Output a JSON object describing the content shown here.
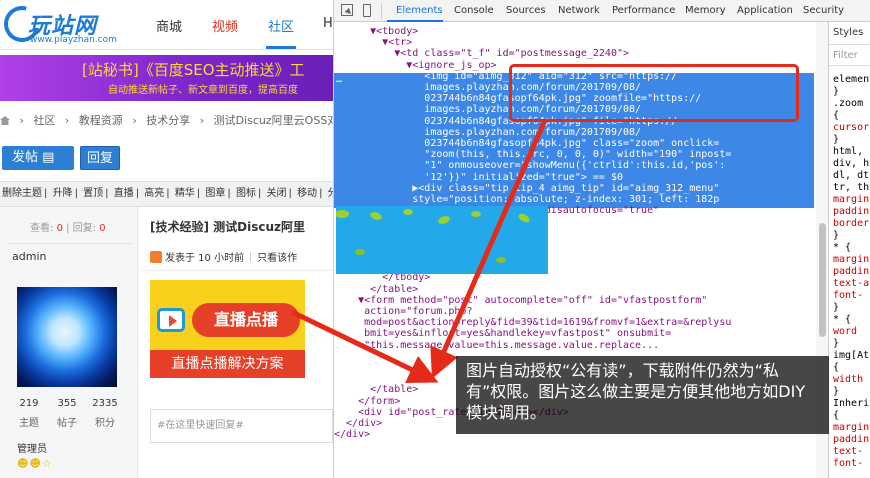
{
  "site": {
    "logo_text": "玩站网",
    "logo_url": "www.playzhan.com",
    "nav": [
      "商城",
      "视频",
      "社区",
      "H"
    ],
    "banner_line1": "[站秘书]《百度SEO主动推送》工",
    "banner_line2": "自动推送新帖子、新文章到百度，提高百度",
    "breadcrumb": [
      "社区",
      "教程资源",
      "技术分享",
      "测试Discuz阿里云OSS对接"
    ],
    "post_button": "发帖",
    "reply_button": "回复",
    "mod_actions": [
      "删除主题",
      "升降",
      "置顶",
      "直播",
      "高亮",
      "精华",
      "图章",
      "图标",
      "关闭",
      "移动",
      "分类"
    ],
    "view_label": "查看:",
    "view_count": "0",
    "reply_label": "回复:",
    "reply_count": "0",
    "author": "admin",
    "stats": [
      {
        "value": "219",
        "label": "主题"
      },
      {
        "value": "355",
        "label": "帖子"
      },
      {
        "value": "2335",
        "label": "积分"
      }
    ],
    "role": "管理员",
    "post_title": "[技术经验] 测试Discuz阿里",
    "post_meta_time": "发表于 10 小时前",
    "post_meta_only": "只看该作",
    "promo_pill": "直播点播",
    "promo_strip": "直播点播解决方案",
    "quick_reply_placeholder": "#在这里快速回复#"
  },
  "devtools": {
    "tabs": [
      "Elements",
      "Console",
      "Sources",
      "Network",
      "Performance",
      "Memory",
      "Application",
      "Security"
    ],
    "active_tab": "Elements",
    "styles_tab": "Styles",
    "filter_placeholder": "Filter",
    "code_lines": [
      "      ▼<tbody>",
      "        ▼<tr>",
      "          ▼<td class=\"t_f\" id=\"postmessage_2240\">",
      "            ▼<ignore_js_op>",
      "               <img id=\"aimg_312\" aid=\"312\" src=\"https://",
      "               images.playzhan.com/forum/201709/08/",
      "               023744b6n84gfasopf64pk.jpg\" zoomfile=\"https://",
      "               images.playzhan.com/forum/201709/08/",
      "               023744b6n84gfasopf64pk.jpg\" file=\"https://",
      "               images.playzhan.com/forum/201709/08/",
      "               023744b6n84gfasopf64pk.jpg\" class=\"zoom\" onclick=",
      "               \"zoom(this, this.src, 0, 0, 0)\" width=\"190\" inpost=",
      "               \"1\" onmouseover=\"showMenu({'ctrlid':this.id,'pos':",
      "               '12'})\" initialized=\"true\"> == $0",
      "             ▶<div class=\"tip tip_4 aimg_tip\" id=\"aimg_312_menu\"",
      "             style=\"position: absolute; z-index: 301; left: 182p",
      "                   display: none;\" disautofocus=\"true\"",
      "                   \"true\">…</div>",
      "                 op>",
      "",
      "",
      "          </tr>",
      "        </tbody>",
      "      </table>",
      "    ▼<form method=\"post\" autocomplete=\"off\" id=\"vfastpostform\"",
      "     action=\"forum.php?",
      "     mod=post&action=reply&fid=39&tid=1619&fromvf=1&extra=&replysu",
      "     bmit=yes&infloat=yes&handlekey=vfastpost\" onsubmit=",
      "     \"this.message.value=this.message.value.replace...",
      "",
      "",
      "",
      "      </table>",
      "    </form>",
      "    <div id=\"post_rate_div_2240\"></div>",
      "  </div>",
      "</div>"
    ],
    "styles_lines": [
      "element",
      "}",
      ".zoom",
      "{",
      "cursor",
      "}",
      "html, b",
      "div, h",
      "dl, dt",
      "tr, th",
      "margin",
      "paddin",
      "border",
      "}",
      "* {",
      "margin",
      "paddin",
      "text-a",
      "font-",
      "}",
      "* {",
      "word",
      "}",
      "img[At",
      "{",
      "width",
      "}",
      "Inherited",
      "{",
      "margin",
      "paddin",
      "text-",
      "font-"
    ]
  },
  "caption": "图片自动授权“公有读”，下载附件仍然为“私有”权限。图片这么做主要是方便其他地方如DIY模块调用。"
}
